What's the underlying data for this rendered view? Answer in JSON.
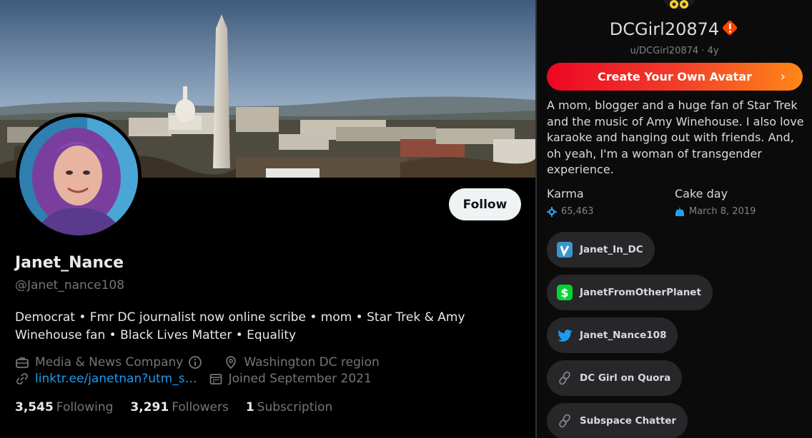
{
  "twitter": {
    "display_name": "Janet_Nance",
    "handle": "@Janet_nance108",
    "follow_label": "Follow",
    "bio_line1": "Democrat • Fmr DC journalist now online scribe • mom • Star Trek & Amy",
    "bio_line2": "Winehouse fan • Black Lives Matter • Equality",
    "category": "Media & News Company",
    "location": "Washington DC region",
    "link": "linktr.ee/janetnan?utm_s…",
    "joined": "Joined September 2021",
    "following_count": "3,545",
    "following_label": "Following",
    "followers_count": "3,291",
    "followers_label": "Followers",
    "subscriptions_count": "1",
    "subscriptions_label": "Subscription",
    "icons": [
      "briefcase-icon",
      "info-icon",
      "location-pin-icon",
      "link-icon",
      "calendar-icon"
    ]
  },
  "reddit": {
    "display_name": "DCGirl20874",
    "username_line": "u/DCGirl20874 · 4y",
    "cta_label": "Create Your Own Avatar",
    "bio": "A mom, blogger and a huge fan of Star Trek and the music of Amy Winehouse. I also love karaoke and hanging out with friends. And, oh yeah, I'm a woman of transgender experience.",
    "karma_label": "Karma",
    "karma_value": "65,463",
    "cakeday_label": "Cake day",
    "cakeday_value": "March 8, 2019",
    "social_links": [
      {
        "label": "Janet_In_DC",
        "icon": "venmo-icon"
      },
      {
        "label": "JanetFromOtherPlanet",
        "icon": "cashapp-icon"
      },
      {
        "label": "Janet_Nance108",
        "icon": "twitter-bird-icon"
      },
      {
        "label": "DC Girl on Quora",
        "icon": "link-icon"
      },
      {
        "label": "Subspace Chatter",
        "icon": "link-icon"
      }
    ]
  },
  "colors": {
    "twitter_link": "#1d9bf0",
    "twitter_muted": "#71767b",
    "reddit_cta_start": "#ec0623",
    "reddit_cta_end": "#ff8717",
    "reddit_pill_bg": "#272729"
  }
}
